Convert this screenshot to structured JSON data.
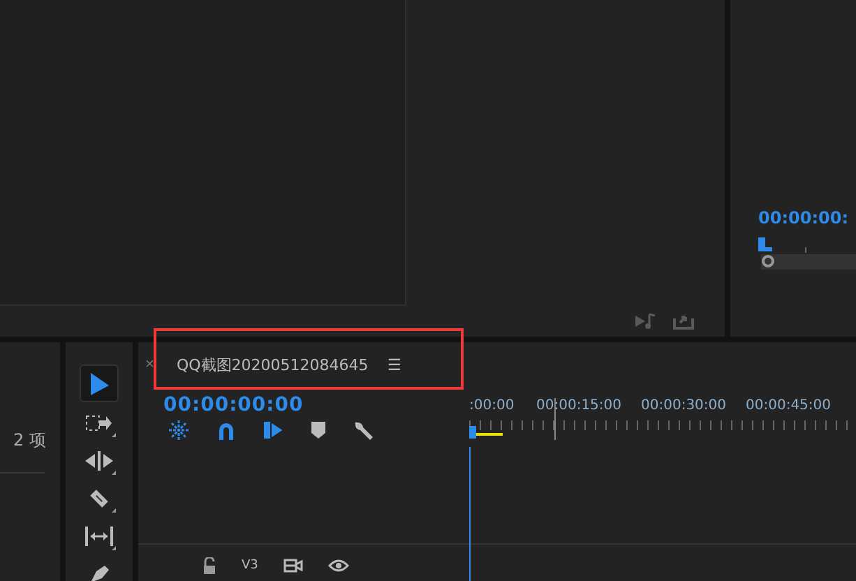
{
  "program_monitor": {
    "timecode": "00:00:00:"
  },
  "project_panel": {
    "item_count": "2 项"
  },
  "tools": [
    {
      "kind": "select",
      "selected": true
    },
    {
      "kind": "track",
      "selected": false
    },
    {
      "kind": "ripple",
      "selected": false
    },
    {
      "kind": "razor",
      "selected": false
    },
    {
      "kind": "slip",
      "selected": false
    },
    {
      "kind": "pen",
      "selected": false
    }
  ],
  "timeline": {
    "close": "×",
    "title": "QQ截图20200512084645",
    "menu": "☰",
    "timecode": "00:00:00:00",
    "ruler": [
      ":00:00",
      "00:00:15:00",
      "00:00:30:00",
      "00:00:45:00"
    ],
    "track": {
      "name": "V3"
    }
  }
}
